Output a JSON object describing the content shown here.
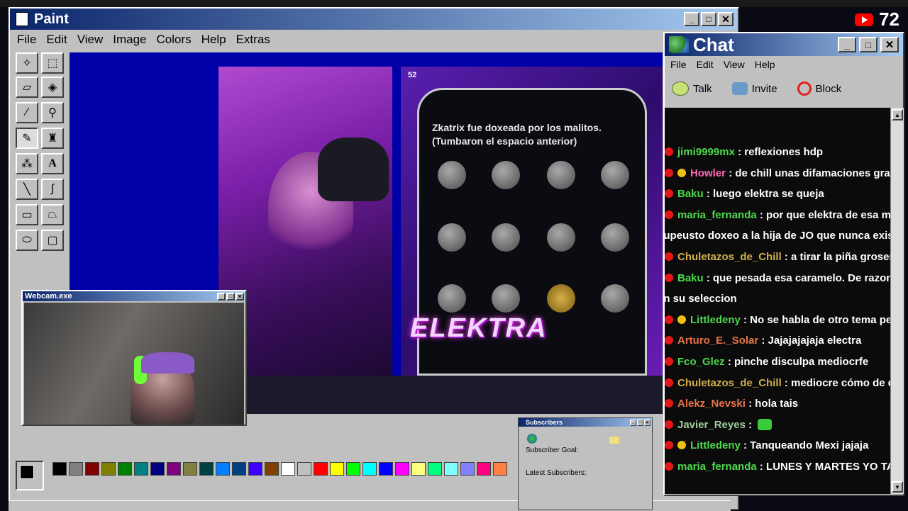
{
  "youtube": {
    "viewers": "72"
  },
  "paint": {
    "title": "Paint",
    "menu": [
      "File",
      "Edit",
      "View",
      "Image",
      "Colors",
      "Help",
      "Extras"
    ]
  },
  "phone_overlay": {
    "headline_line1": "Zkatrix fue doxeada por los malitos.",
    "headline_line2": "(Tumbaron el espacio anterior)",
    "logo_text": "ELEKTRA",
    "count": "52"
  },
  "webcam": {
    "title": "Webcam.exe"
  },
  "subscribers": {
    "title": "Subscribers",
    "goal_label": "Subscriber Goal:",
    "latest_label": "Latest Subscribers:"
  },
  "chat": {
    "title": "Chat",
    "menu": [
      "File",
      "Edit",
      "View",
      "Help"
    ],
    "tools": [
      "Talk",
      "Invite",
      "Block"
    ],
    "messages": [
      {
        "user": "jimi9999mx",
        "text": ": reflexiones hdp",
        "color": "#4fd84f",
        "badge": false
      },
      {
        "user": "Howler",
        "text": ": de chill unas difamaciones gratuita",
        "color": "#ff69b4",
        "badge": true
      },
      {
        "user": "Baku",
        "text": ": luego elektra se queja",
        "color": "#4fd84f",
        "badge": false
      },
      {
        "user": "maria_fernanda",
        "text": ": por que elektra de esa mane",
        "color": "#4fd84f",
        "badge": false
      },
      {
        "user": "",
        "text": "supeusto doxeo a la hija de JO que nunca existio",
        "color": "#fff",
        "badge": false,
        "continuation": true
      },
      {
        "user": "Chuletazos_de_Chill",
        "text": ": a tirar la piña groserita",
        "color": "#d2b04c",
        "badge": false
      },
      {
        "user": "Baku",
        "text": ": que pesada esa caramelo. De razon no l",
        "color": "#4fd84f",
        "badge": false
      },
      {
        "user": "",
        "text": "en su seleccion",
        "color": "#fff",
        "badge": false,
        "continuation": true
      },
      {
        "user": "Littledeny",
        "text": ": No se habla de otro tema pero a",
        "color": "#4fd84f",
        "badge": true
      },
      {
        "user": "Arturo_E._Solar",
        "text": ": Jajajajajaja electra",
        "color": "#e8734a",
        "badge": false
      },
      {
        "user": "Fco_Glez",
        "text": ": pinche disculpa mediocrfe",
        "color": "#4fd84f",
        "badge": false
      },
      {
        "user": "Chuletazos_de_Chill",
        "text": ": mediocre cómo de donc",
        "color": "#d2b04c",
        "badge": false
      },
      {
        "user": "Alekz_Nevski",
        "text": ": hola tais",
        "color": "#e8734a",
        "badge": false
      },
      {
        "user": "Javier_Reyes",
        "text": ":",
        "color": "#9ecf9e",
        "badge": false,
        "emote": true
      },
      {
        "user": "Littledeny",
        "text": ": Tanqueando Mexi jajaja",
        "color": "#4fd84f",
        "badge": true
      },
      {
        "user": "maria_fernanda",
        "text": ": LUNES Y MARTES YO TANK",
        "color": "#4fd84f",
        "badge": false
      }
    ]
  },
  "palette_colors": [
    "#000000",
    "#808080",
    "#800000",
    "#808000",
    "#008000",
    "#008080",
    "#000080",
    "#800080",
    "#808040",
    "#004040",
    "#0080ff",
    "#004080",
    "#4000ff",
    "#804000",
    "#ffffff",
    "#c0c0c0",
    "#ff0000",
    "#ffff00",
    "#00ff00",
    "#00ffff",
    "#0000ff",
    "#ff00ff",
    "#ffff80",
    "#00ff80",
    "#80ffff",
    "#8080ff",
    "#ff0080",
    "#ff8040"
  ]
}
